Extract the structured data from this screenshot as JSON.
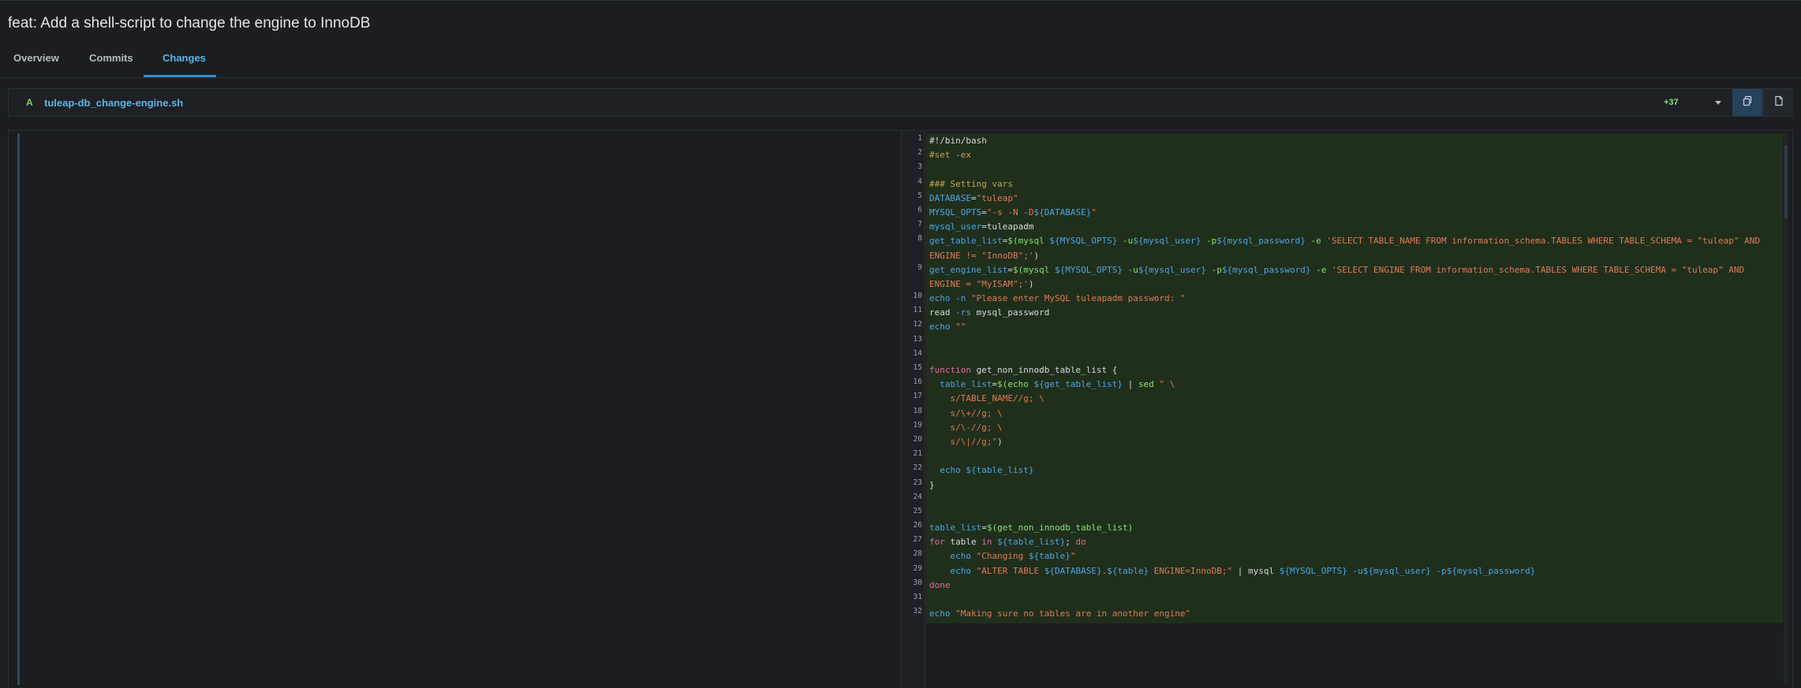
{
  "title": "feat: Add a shell-script to change the engine to InnoDB",
  "tabs": [
    {
      "label": "Overview"
    },
    {
      "label": "Commits"
    },
    {
      "label": "Changes"
    }
  ],
  "file": {
    "status": "A",
    "name": "tuleap-db_change-engine.sh",
    "additions": "+37"
  },
  "icons": {
    "dropdown": "caret-down-icon",
    "side_by_side": "copy-icon",
    "file": "file-icon"
  },
  "colors": {
    "accent": "#5bb4e8",
    "added": "#7fd36b",
    "added_bg": "#1f2f1c"
  },
  "code": [
    {
      "n": "1",
      "tokens": [
        [
          "c-plain",
          "#!/bin/bash"
        ]
      ]
    },
    {
      "n": "2",
      "tokens": [
        [
          "c-cmt",
          "#set -ex"
        ]
      ]
    },
    {
      "n": "3",
      "tokens": []
    },
    {
      "n": "4",
      "tokens": [
        [
          "c-cmt",
          "### Setting vars"
        ]
      ]
    },
    {
      "n": "5",
      "tokens": [
        [
          "c-var",
          "DATABASE"
        ],
        [
          "c-plain",
          "="
        ],
        [
          "c-str",
          "\"tuleap\""
        ]
      ]
    },
    {
      "n": "6",
      "tokens": [
        [
          "c-var",
          "MYSQL_OPTS"
        ],
        [
          "c-plain",
          "="
        ],
        [
          "c-str",
          "\"-s -N -D"
        ],
        [
          "c-var",
          "${DATABASE}"
        ],
        [
          "c-str",
          "\""
        ]
      ]
    },
    {
      "n": "7",
      "tokens": [
        [
          "c-var",
          "mysql_user"
        ],
        [
          "c-plain",
          "=tuleapadm"
        ]
      ]
    },
    {
      "n": "8",
      "tall": true,
      "tokens": [
        [
          "c-var",
          "get_table_list"
        ],
        [
          "c-plain",
          "="
        ],
        [
          "c-fn",
          "$(mysql "
        ],
        [
          "c-var",
          "${MYSQL_OPTS}"
        ],
        [
          "c-fn",
          " -u"
        ],
        [
          "c-var",
          "${mysql_user}"
        ],
        [
          "c-fn",
          " -p"
        ],
        [
          "c-var",
          "${mysql_password}"
        ],
        [
          "c-fn",
          " -e "
        ],
        [
          "c-str",
          "'SELECT TABLE_NAME FROM information_schema.TABLES WHERE TABLE_SCHEMA = \"tuleap\" AND ENGINE != \"InnoDB\";'"
        ],
        [
          "c-plain",
          ")"
        ]
      ]
    },
    {
      "n": "9",
      "tall": true,
      "tokens": [
        [
          "c-var",
          "get_engine_list"
        ],
        [
          "c-plain",
          "="
        ],
        [
          "c-fn",
          "$(mysql "
        ],
        [
          "c-var",
          "${MYSQL_OPTS}"
        ],
        [
          "c-fn",
          " -u"
        ],
        [
          "c-var",
          "${mysql_user}"
        ],
        [
          "c-fn",
          " -p"
        ],
        [
          "c-var",
          "${mysql_password}"
        ],
        [
          "c-fn",
          " -e "
        ],
        [
          "c-str",
          "'SELECT ENGINE FROM information_schema.TABLES WHERE TABLE_SCHEMA = \"tuleap\" AND ENGINE = \"MyISAM\";'"
        ],
        [
          "c-plain",
          ")"
        ]
      ]
    },
    {
      "n": "10",
      "tokens": [
        [
          "c-var",
          "echo"
        ],
        [
          "c-plain",
          " "
        ],
        [
          "c-var",
          "-n"
        ],
        [
          "c-plain",
          " "
        ],
        [
          "c-str",
          "\"Please enter MySQL tuleapadm password: \""
        ]
      ]
    },
    {
      "n": "11",
      "tokens": [
        [
          "c-plain",
          "read "
        ],
        [
          "c-var",
          "-rs"
        ],
        [
          "c-plain",
          " mysql_password"
        ]
      ]
    },
    {
      "n": "12",
      "tokens": [
        [
          "c-var",
          "echo"
        ],
        [
          "c-plain",
          " "
        ],
        [
          "c-str",
          "\"\""
        ]
      ]
    },
    {
      "n": "13",
      "tokens": []
    },
    {
      "n": "14",
      "tokens": []
    },
    {
      "n": "15",
      "tokens": [
        [
          "c-kw",
          "function"
        ],
        [
          "c-plain",
          " get_non_innodb_table_list {"
        ]
      ]
    },
    {
      "n": "16",
      "tokens": [
        [
          "c-plain",
          "  "
        ],
        [
          "c-var",
          "table_list"
        ],
        [
          "c-plain",
          "="
        ],
        [
          "c-fn",
          "$(echo "
        ],
        [
          "c-var",
          "${get_table_list}"
        ],
        [
          "c-plain",
          " | "
        ],
        [
          "c-fn",
          "sed"
        ],
        [
          "c-plain",
          " "
        ],
        [
          "c-str",
          "\" \\"
        ]
      ]
    },
    {
      "n": "17",
      "tokens": [
        [
          "c-str",
          "    s/TABLE_NAME//g; \\"
        ]
      ]
    },
    {
      "n": "18",
      "tokens": [
        [
          "c-str",
          "    s/\\+//g; \\"
        ]
      ]
    },
    {
      "n": "19",
      "tokens": [
        [
          "c-str",
          "    s/\\-//g; \\"
        ]
      ]
    },
    {
      "n": "20",
      "tokens": [
        [
          "c-str",
          "    s/\\|//g;\""
        ],
        [
          "c-plain",
          ")"
        ]
      ]
    },
    {
      "n": "21",
      "tokens": []
    },
    {
      "n": "22",
      "tokens": [
        [
          "c-plain",
          "  "
        ],
        [
          "c-var",
          "echo"
        ],
        [
          "c-plain",
          " "
        ],
        [
          "c-var",
          "${table_list}"
        ]
      ]
    },
    {
      "n": "23",
      "tokens": [
        [
          "c-plain",
          "}"
        ]
      ]
    },
    {
      "n": "24",
      "tokens": []
    },
    {
      "n": "25",
      "tokens": []
    },
    {
      "n": "26",
      "tokens": [
        [
          "c-var",
          "table_list"
        ],
        [
          "c-plain",
          "="
        ],
        [
          "c-fn",
          "$(get_non_innodb_table_list)"
        ]
      ]
    },
    {
      "n": "27",
      "tokens": [
        [
          "c-kw",
          "for"
        ],
        [
          "c-plain",
          " table "
        ],
        [
          "c-kw",
          "in"
        ],
        [
          "c-plain",
          " "
        ],
        [
          "c-var",
          "${table_list}"
        ],
        [
          "c-plain",
          "; "
        ],
        [
          "c-kw",
          "do"
        ]
      ]
    },
    {
      "n": "28",
      "tokens": [
        [
          "c-plain",
          "    "
        ],
        [
          "c-var",
          "echo"
        ],
        [
          "c-plain",
          " "
        ],
        [
          "c-str",
          "\"Changing "
        ],
        [
          "c-var",
          "${table}"
        ],
        [
          "c-str",
          "\""
        ]
      ]
    },
    {
      "n": "29",
      "tokens": [
        [
          "c-plain",
          "    "
        ],
        [
          "c-var",
          "echo"
        ],
        [
          "c-plain",
          " "
        ],
        [
          "c-str",
          "\"ALTER TABLE "
        ],
        [
          "c-var",
          "${DATABASE}"
        ],
        [
          "c-str",
          "."
        ],
        [
          "c-var",
          "${table}"
        ],
        [
          "c-str",
          " ENGINE=InnoDB;\""
        ],
        [
          "c-plain",
          " | mysql "
        ],
        [
          "c-var",
          "${MYSQL_OPTS}"
        ],
        [
          "c-plain",
          " "
        ],
        [
          "c-var",
          "-u${mysql_user}"
        ],
        [
          "c-plain",
          " "
        ],
        [
          "c-var",
          "-p${mysql_password}"
        ]
      ]
    },
    {
      "n": "30",
      "tokens": [
        [
          "c-kw",
          "done"
        ]
      ]
    },
    {
      "n": "31",
      "tokens": []
    },
    {
      "n": "32",
      "tokens": [
        [
          "c-var",
          "echo"
        ],
        [
          "c-plain",
          " "
        ],
        [
          "c-str",
          "\"Making sure no tables are in another engine\""
        ]
      ]
    }
  ]
}
